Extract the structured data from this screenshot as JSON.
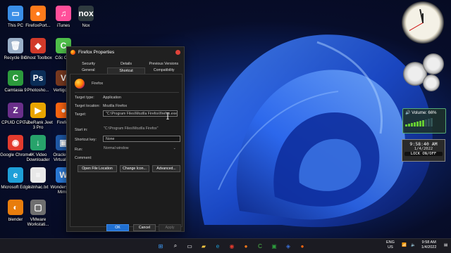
{
  "desktop": {
    "icons": [
      {
        "label": "This PC",
        "color": "#3a8ee6",
        "glyph": "▭"
      },
      {
        "label": "FirefoxPort...",
        "color": "#ff7a1a",
        "glyph": "●"
      },
      {
        "label": "iTunes",
        "color": "#ff4f9a",
        "glyph": "♫"
      },
      {
        "label": "Nox",
        "color": "#2f3b3f",
        "glyph": "nox"
      },
      {
        "label": "Recycle Bin",
        "color": "#9bb0c8",
        "glyph": "🗑"
      },
      {
        "label": "Ghost Toolbox",
        "color": "#d23a2a",
        "glyph": "◆"
      },
      {
        "label": "Cốc Cốc",
        "color": "#4fbf4a",
        "glyph": "C"
      },
      {
        "label": "Camtasia 9",
        "color": "#2c9a3c",
        "glyph": "C"
      },
      {
        "label": "Photosho...",
        "color": "#0b2d57",
        "glyph": "Ps"
      },
      {
        "label": "VertigoC...",
        "color": "#7a3a20",
        "glyph": "V"
      },
      {
        "label": "CPUID CPU-Z",
        "color": "#6a2f8a",
        "glyph": "Z"
      },
      {
        "label": "TubeRank Jeet 3 Pro",
        "color": "#e8a400",
        "glyph": "▶"
      },
      {
        "label": "Firefox",
        "color": "#ff6611",
        "glyph": "●"
      },
      {
        "label": "Google Chrome",
        "color": "#e33b2e",
        "glyph": "◉"
      },
      {
        "label": "4K Video Downloader",
        "color": "#27a36b",
        "glyph": "↓"
      },
      {
        "label": "Oracle VM VirtualBox",
        "color": "#1f5aa8",
        "glyph": "▣"
      },
      {
        "label": "Microsoft Edge",
        "color": "#1e9fd8",
        "glyph": "e"
      },
      {
        "label": "listnhac.txt",
        "color": "#e8e8e8",
        "glyph": "≡"
      },
      {
        "label": "Wondershare Mirror",
        "color": "#2a7ad8",
        "glyph": "W"
      },
      {
        "label": "blender",
        "color": "#e87d0d",
        "glyph": "◐"
      },
      {
        "label": "VMware Workstati...",
        "color": "#6f6f6f",
        "glyph": "▢"
      }
    ]
  },
  "dialog": {
    "title": "Firefox Properties",
    "tabs_row1": [
      "Security",
      "Details",
      "Previous Versions"
    ],
    "tabs_row2": [
      "General",
      "Shortcut",
      "Compatibility"
    ],
    "active_tab": "Shortcut",
    "app_name": "Firefox",
    "fields": {
      "target_type_label": "Target type:",
      "target_type_value": "Application",
      "target_location_label": "Target location:",
      "target_location_value": "Mozilla Firefox",
      "target_label": "Target:",
      "target_value": "\"C:\\Program Files\\Mozilla Firefox\\firefox.exe\"",
      "start_in_label": "Start in:",
      "start_in_value": "\"C:\\Program Files\\Mozilla Firefox\"",
      "shortcut_key_label": "Shortcut key:",
      "shortcut_key_value": "None",
      "run_label": "Run:",
      "run_value": "Normal window",
      "comment_label": "Comment:",
      "comment_value": ""
    },
    "buttons": {
      "open_file_location": "Open File Location",
      "change_icon": "Change Icon...",
      "advanced": "Advanced...",
      "ok": "OK",
      "cancel": "Cancel",
      "apply": "Apply"
    }
  },
  "gadgets": {
    "volume_label": "Volume: 66%",
    "digital_time": "9:58:40 AM",
    "digital_date": "1/4/2022",
    "lock_label": "LOCK ON/OFF"
  },
  "taskbar": {
    "language": "ENG",
    "region": "US",
    "time": "9:58 AM",
    "date": "1/4/2022"
  },
  "colors": {
    "accent": "#1f6fd1",
    "dialog_bg": "#202020",
    "taskbar_bg": "#1b1b22"
  }
}
